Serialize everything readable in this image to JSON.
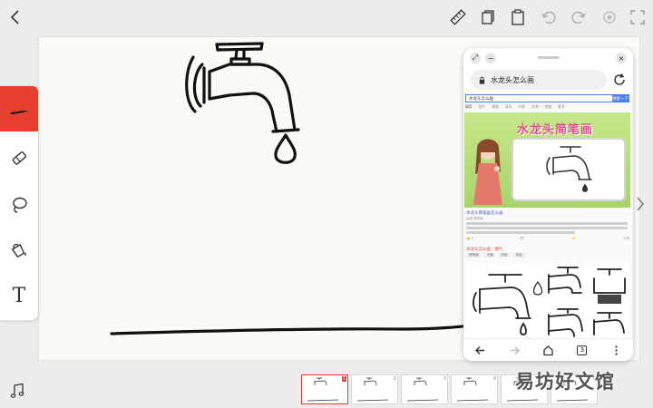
{
  "topbar": {
    "icons": [
      "back-icon",
      "ruler-icon",
      "copy-icon",
      "paste-icon",
      "undo-icon",
      "redo-icon",
      "record-icon",
      "fullscreen-icon"
    ]
  },
  "toolbox": {
    "tools": [
      "pen-tool",
      "eraser-tool",
      "lasso-tool",
      "fill-bucket-tool",
      "text-tool"
    ],
    "active": "pen-tool",
    "active_color": "#e8402e",
    "text_tool_glyph": "T"
  },
  "browser": {
    "search_text": "水龙头怎么画",
    "page": {
      "query": "水龙头怎么画",
      "search_button": "搜索一下",
      "tabs": [
        "网页",
        "图片",
        "视频",
        "资讯",
        "问答",
        "文库",
        "地图",
        "更多"
      ],
      "hero_title": "水龙头简笔画",
      "result_title": "水龙头简笔画怎么画",
      "result_meta": "绘画·简笔画",
      "result_stats": [
        "👍 9",
        "💬",
        "⭐",
        "分享"
      ],
      "images_title": "水龙头怎么画 - 图片",
      "image_tags": [
        "简笔画",
        "卡通",
        "彩色",
        "手绘"
      ]
    },
    "tab_count": "3",
    "nav_icons": [
      "back-arrow-icon",
      "forward-arrow-icon",
      "home-icon",
      "tabs-icon",
      "more-icon"
    ]
  },
  "filmstrip": {
    "pages": [
      "1",
      "2",
      "3",
      "4",
      "5",
      "6"
    ],
    "active_page": "1"
  },
  "watermark": {
    "text": "易坊好文馆"
  },
  "colors": {
    "accent": "#e8402e",
    "canvas": "#fbfaf7",
    "ink": "#111111",
    "link": "#3b5db7"
  }
}
